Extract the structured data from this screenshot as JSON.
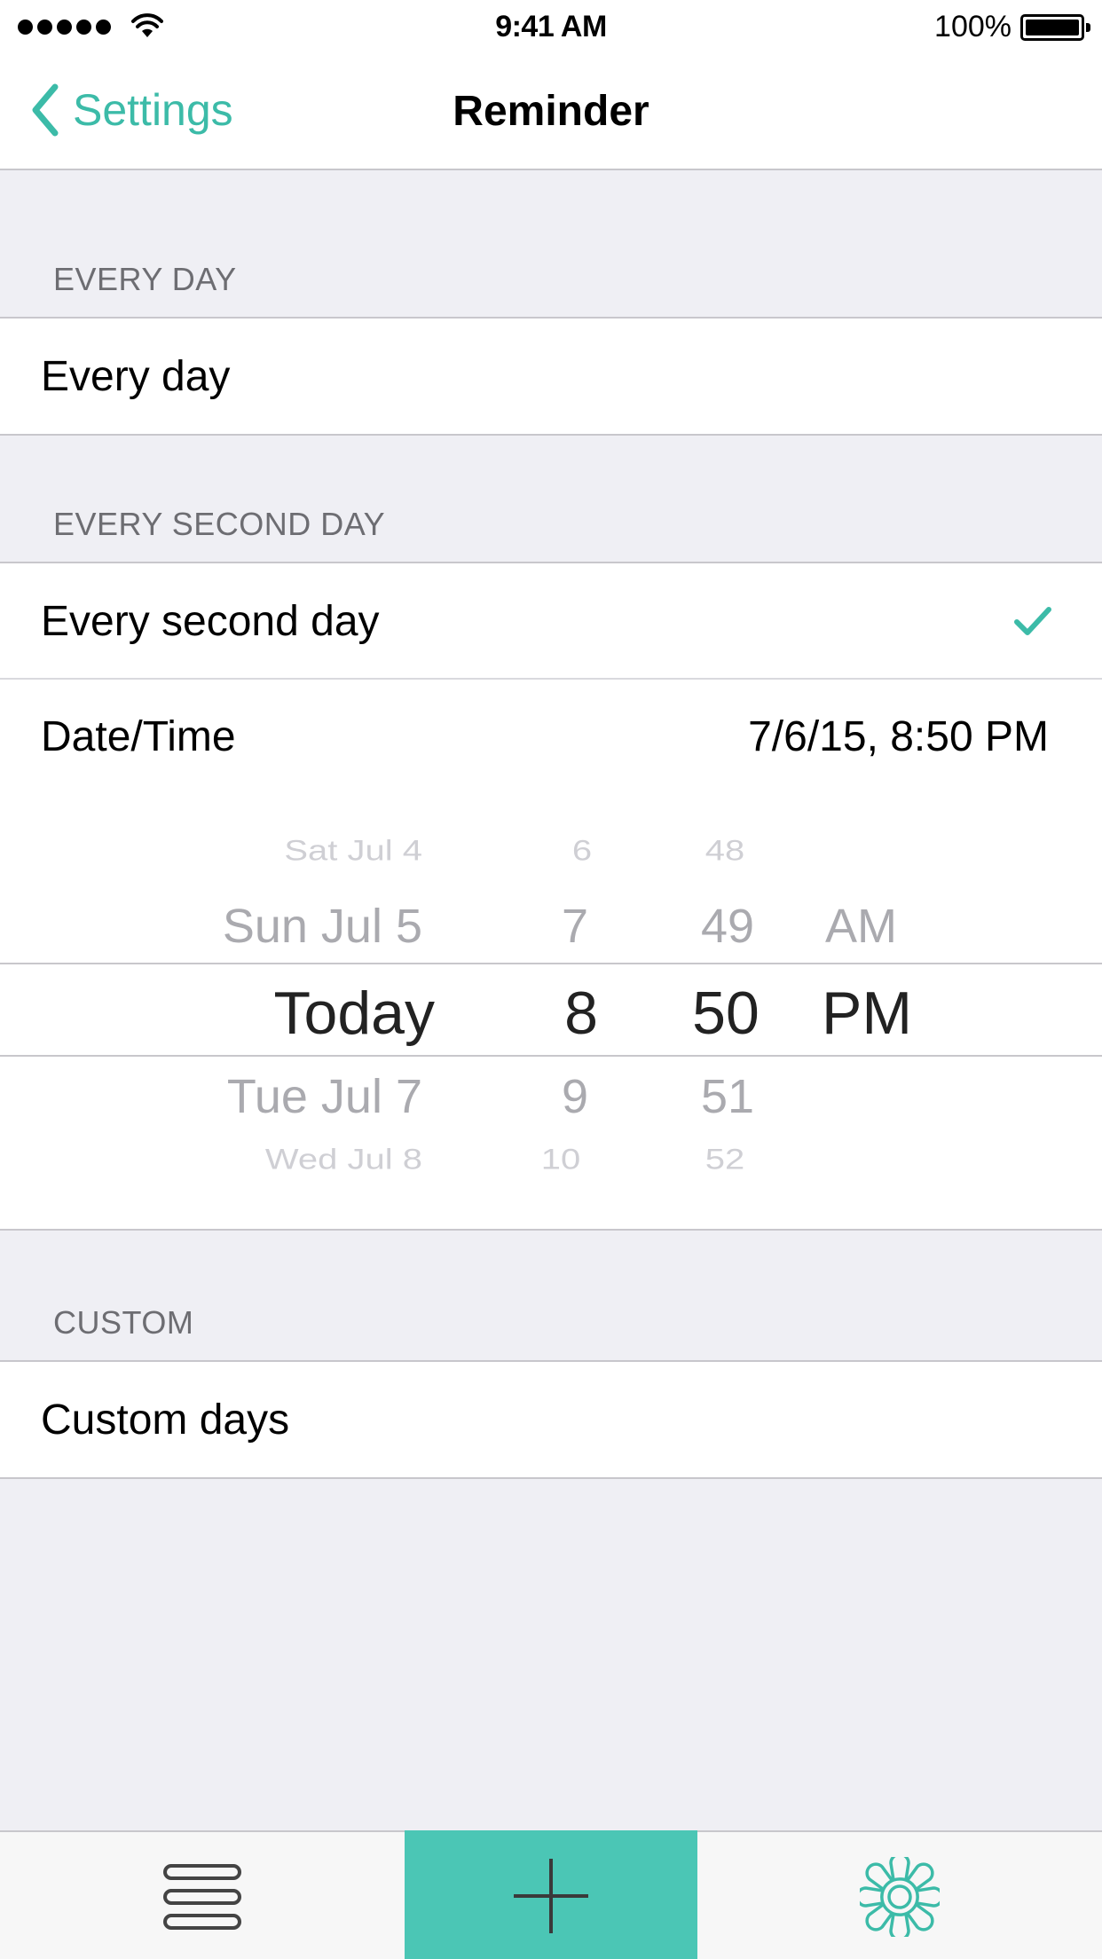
{
  "status_bar": {
    "time": "9:41 AM",
    "battery_percent": "100%"
  },
  "nav": {
    "back_label": "Settings",
    "title": "Reminder"
  },
  "sections": {
    "every_day": {
      "header": "EVERY DAY",
      "row_label": "Every day"
    },
    "every_second_day": {
      "header": "EVERY SECOND DAY",
      "row_label": "Every second day",
      "selected": true,
      "datetime_label": "Date/Time",
      "datetime_value": "7/6/15, 8:50 PM"
    },
    "custom": {
      "header": "CUSTOM",
      "row_label": "Custom days"
    }
  },
  "picker": {
    "dates": [
      "Sat Jul 4",
      "Sun Jul 5",
      "Today",
      "Tue Jul 7",
      "Wed Jul 8"
    ],
    "hours": [
      "6",
      "7",
      "8",
      "9",
      "10"
    ],
    "minutes": [
      "48",
      "49",
      "50",
      "51",
      "52"
    ],
    "periods": [
      "",
      "AM",
      "PM",
      "",
      ""
    ],
    "selected_index": 2
  },
  "tabbar": {
    "items": [
      "list-icon",
      "add-icon",
      "gear-icon"
    ]
  },
  "colors": {
    "accent": "#3cbba8",
    "tab_active_bg": "#4bc6b5",
    "background": "#efeff4"
  }
}
